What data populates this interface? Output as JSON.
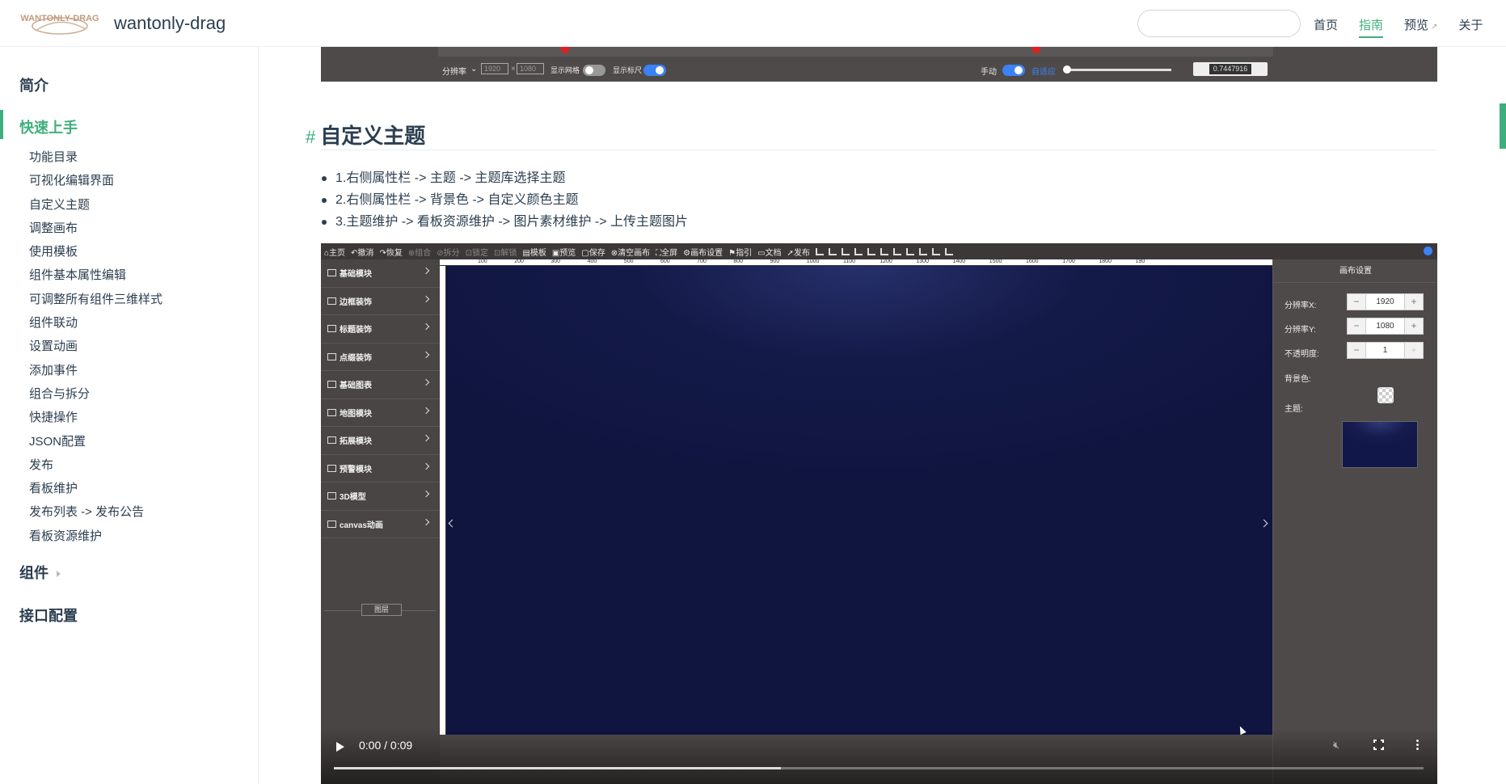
{
  "header": {
    "logo_text": "WANTONLY-DRAG",
    "site_name": "wantonly-drag",
    "search": {
      "placeholder": ""
    },
    "nav": [
      {
        "label": "首页",
        "active": false
      },
      {
        "label": "指南",
        "active": true
      },
      {
        "label": "预览",
        "active": false,
        "external": true
      },
      {
        "label": "关于",
        "active": false
      }
    ]
  },
  "sidebar": {
    "groups": [
      {
        "label": "简介"
      },
      {
        "label": "快速上手",
        "active": true
      },
      {
        "label": "组件",
        "collapsed": true
      },
      {
        "label": "接口配置"
      }
    ],
    "items": [
      "功能目录",
      "可视化编辑界面",
      "自定义主题",
      "调整画布",
      "使用模板",
      "组件基本属性编辑",
      "可调整所有组件三维样式",
      "组件联动",
      "设置动画",
      "添加事件",
      "组合与拆分",
      "快捷操作",
      "JSON配置",
      "发布",
      "看板维护",
      "发布列表 -> 发布公告",
      "看板资源维护"
    ]
  },
  "top_strip": {
    "resolution_label": "分辨率",
    "res_x": "1920",
    "res_y": "1080",
    "grid_label": "显示网格",
    "grid_on": false,
    "ruler_label": "显示标尺",
    "ruler_on": true,
    "manual_label": "手动",
    "manual_on": true,
    "adaptive_label": "自适应",
    "zoom_value": "0.7447916"
  },
  "section": {
    "hash": "#",
    "title": "自定义主题",
    "bullets": [
      "1.右侧属性栏 -> 主题 -> 主题库选择主题",
      "2.右侧属性栏 -> 背景色 -> 自定义颜色主题",
      "3.主题维护 -> 看板资源维护 -> 图片素材维护 -> 上传主题图片"
    ]
  },
  "editor": {
    "toolbar": [
      {
        "label": "⌂主页",
        "dim": false
      },
      {
        "label": "↶撤消",
        "dim": false
      },
      {
        "label": "↷恢复",
        "dim": false
      },
      {
        "label": "⊕组合",
        "dim": true
      },
      {
        "label": "⊘拆分",
        "dim": true
      },
      {
        "label": "⊡锁定",
        "dim": true
      },
      {
        "label": "⊡解锁",
        "dim": true
      },
      {
        "label": "▤模板",
        "dim": false
      },
      {
        "label": "▣预览",
        "dim": false
      },
      {
        "label": "▢保存",
        "dim": false
      },
      {
        "label": "⊗清空画布",
        "dim": false
      },
      {
        "label": "⛶全屏",
        "dim": false
      },
      {
        "label": "⚙画布设置",
        "dim": false
      },
      {
        "label": "⚑指引",
        "dim": false
      },
      {
        "label": "▭文档",
        "dim": false
      },
      {
        "label": "➚发布",
        "dim": false
      }
    ],
    "components": [
      "基础模块",
      "边框装饰",
      "标题装饰",
      "点缀装饰",
      "基础图表",
      "地图模块",
      "拓展模块",
      "预警模块",
      "3D模型",
      "canvas动画"
    ],
    "layer_button": "图层",
    "ruler_ticks": [
      "100",
      "200",
      "300",
      "400",
      "500",
      "600",
      "700",
      "800",
      "900",
      "1000",
      "1100",
      "1200",
      "1300",
      "1400",
      "1500",
      "1600",
      "1700",
      "1800",
      "190"
    ],
    "panel": {
      "title": "画布设置",
      "res_x_label": "分辨率X:",
      "res_x_value": "1920",
      "res_y_label": "分辨率Y:",
      "res_y_value": "1080",
      "opacity_label": "不透明度:",
      "opacity_value": "1",
      "bg_label": "背景色:",
      "theme_label": "主题:"
    }
  },
  "video": {
    "time": "0:00 / 0:09",
    "progress": 0.41,
    "muted": true
  },
  "colors": {
    "accent": "#3eaf7c",
    "text": "#2c3e50",
    "editor_bg": "#4f4a4a",
    "canvas_bg": "#141a48",
    "toggle_on": "#3b82f6"
  }
}
